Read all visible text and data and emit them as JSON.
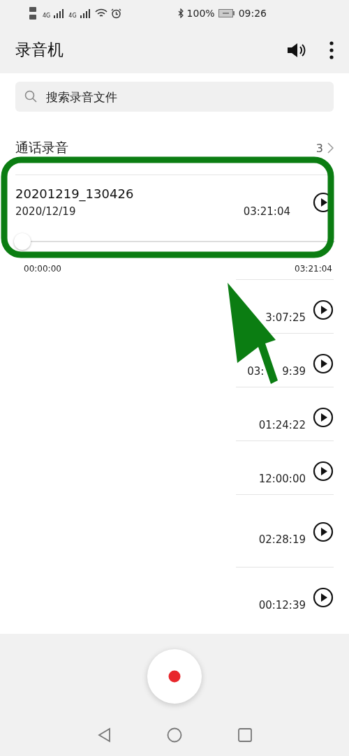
{
  "status_bar": {
    "network_1": "4G",
    "network_2": "4G",
    "battery": "100%",
    "time": "09:26"
  },
  "app_bar": {
    "title": "录音机"
  },
  "search": {
    "placeholder": "搜索录音文件"
  },
  "section": {
    "title": "通话录音",
    "count": "3"
  },
  "current": {
    "name": "20201219_130426",
    "date": "2020/12/19",
    "duration": "03:21:04",
    "level": 0,
    "elapsed": "00:00:00",
    "total": "03:21:04"
  },
  "recordings": [
    {
      "parts": [
        "3:07:25"
      ]
    },
    {
      "parts": [
        "03:",
        "9:39"
      ]
    },
    {
      "parts": [
        "01:24:22"
      ]
    },
    {
      "parts": [
        "12:00:00"
      ]
    },
    {
      "parts": [
        "02:28:19"
      ],
      "tall": true
    },
    {
      "parts": [
        "00:12:39"
      ]
    }
  ]
}
